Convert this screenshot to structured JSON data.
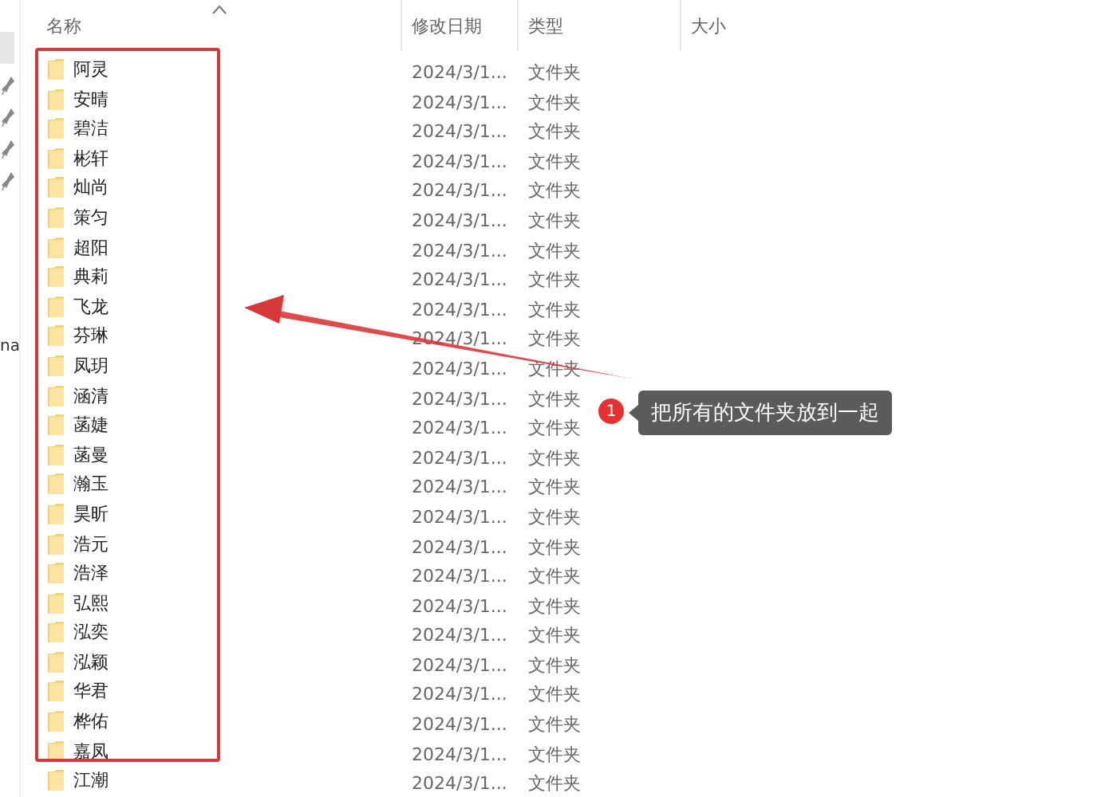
{
  "sidebar": {
    "pinned_count_label": "na"
  },
  "table": {
    "columns": [
      {
        "label": "名称",
        "sorted": true
      },
      {
        "label": "修改日期",
        "sorted": false
      },
      {
        "label": "类型",
        "sorted": false
      },
      {
        "label": "大小",
        "sorted": false
      }
    ],
    "rows": [
      {
        "name": "阿灵",
        "date": "2024/3/1...",
        "type": "文件夹"
      },
      {
        "name": "安晴",
        "date": "2024/3/1...",
        "type": "文件夹"
      },
      {
        "name": "碧洁",
        "date": "2024/3/1...",
        "type": "文件夹"
      },
      {
        "name": "彬轩",
        "date": "2024/3/1...",
        "type": "文件夹"
      },
      {
        "name": "灿尚",
        "date": "2024/3/1...",
        "type": "文件夹"
      },
      {
        "name": "策匀",
        "date": "2024/3/1...",
        "type": "文件夹"
      },
      {
        "name": "超阳",
        "date": "2024/3/1...",
        "type": "文件夹"
      },
      {
        "name": "典莉",
        "date": "2024/3/1...",
        "type": "文件夹"
      },
      {
        "name": "飞龙",
        "date": "2024/3/1...",
        "type": "文件夹"
      },
      {
        "name": "芬琳",
        "date": "2024/3/1...",
        "type": "文件夹"
      },
      {
        "name": "凤玥",
        "date": "2024/3/1...",
        "type": "文件夹"
      },
      {
        "name": "涵清",
        "date": "2024/3/1...",
        "type": "文件夹"
      },
      {
        "name": "菡婕",
        "date": "2024/3/1...",
        "type": "文件夹"
      },
      {
        "name": "菡曼",
        "date": "2024/3/1...",
        "type": "文件夹"
      },
      {
        "name": "瀚玉",
        "date": "2024/3/1...",
        "type": "文件夹"
      },
      {
        "name": "昊昕",
        "date": "2024/3/1...",
        "type": "文件夹"
      },
      {
        "name": "浩元",
        "date": "2024/3/1...",
        "type": "文件夹"
      },
      {
        "name": "浩泽",
        "date": "2024/3/1...",
        "type": "文件夹"
      },
      {
        "name": "弘熙",
        "date": "2024/3/1...",
        "type": "文件夹"
      },
      {
        "name": "泓奕",
        "date": "2024/3/1...",
        "type": "文件夹"
      },
      {
        "name": "泓颖",
        "date": "2024/3/1...",
        "type": "文件夹"
      },
      {
        "name": "华君",
        "date": "2024/3/1...",
        "type": "文件夹"
      },
      {
        "name": "桦佑",
        "date": "2024/3/1...",
        "type": "文件夹"
      },
      {
        "name": "嘉凤",
        "date": "2024/3/1...",
        "type": "文件夹"
      },
      {
        "name": "江潮",
        "date": "2024/3/1...",
        "type": "文件夹"
      }
    ]
  },
  "annotation": {
    "step": "1",
    "text": "把所有的文件夹放到一起"
  }
}
